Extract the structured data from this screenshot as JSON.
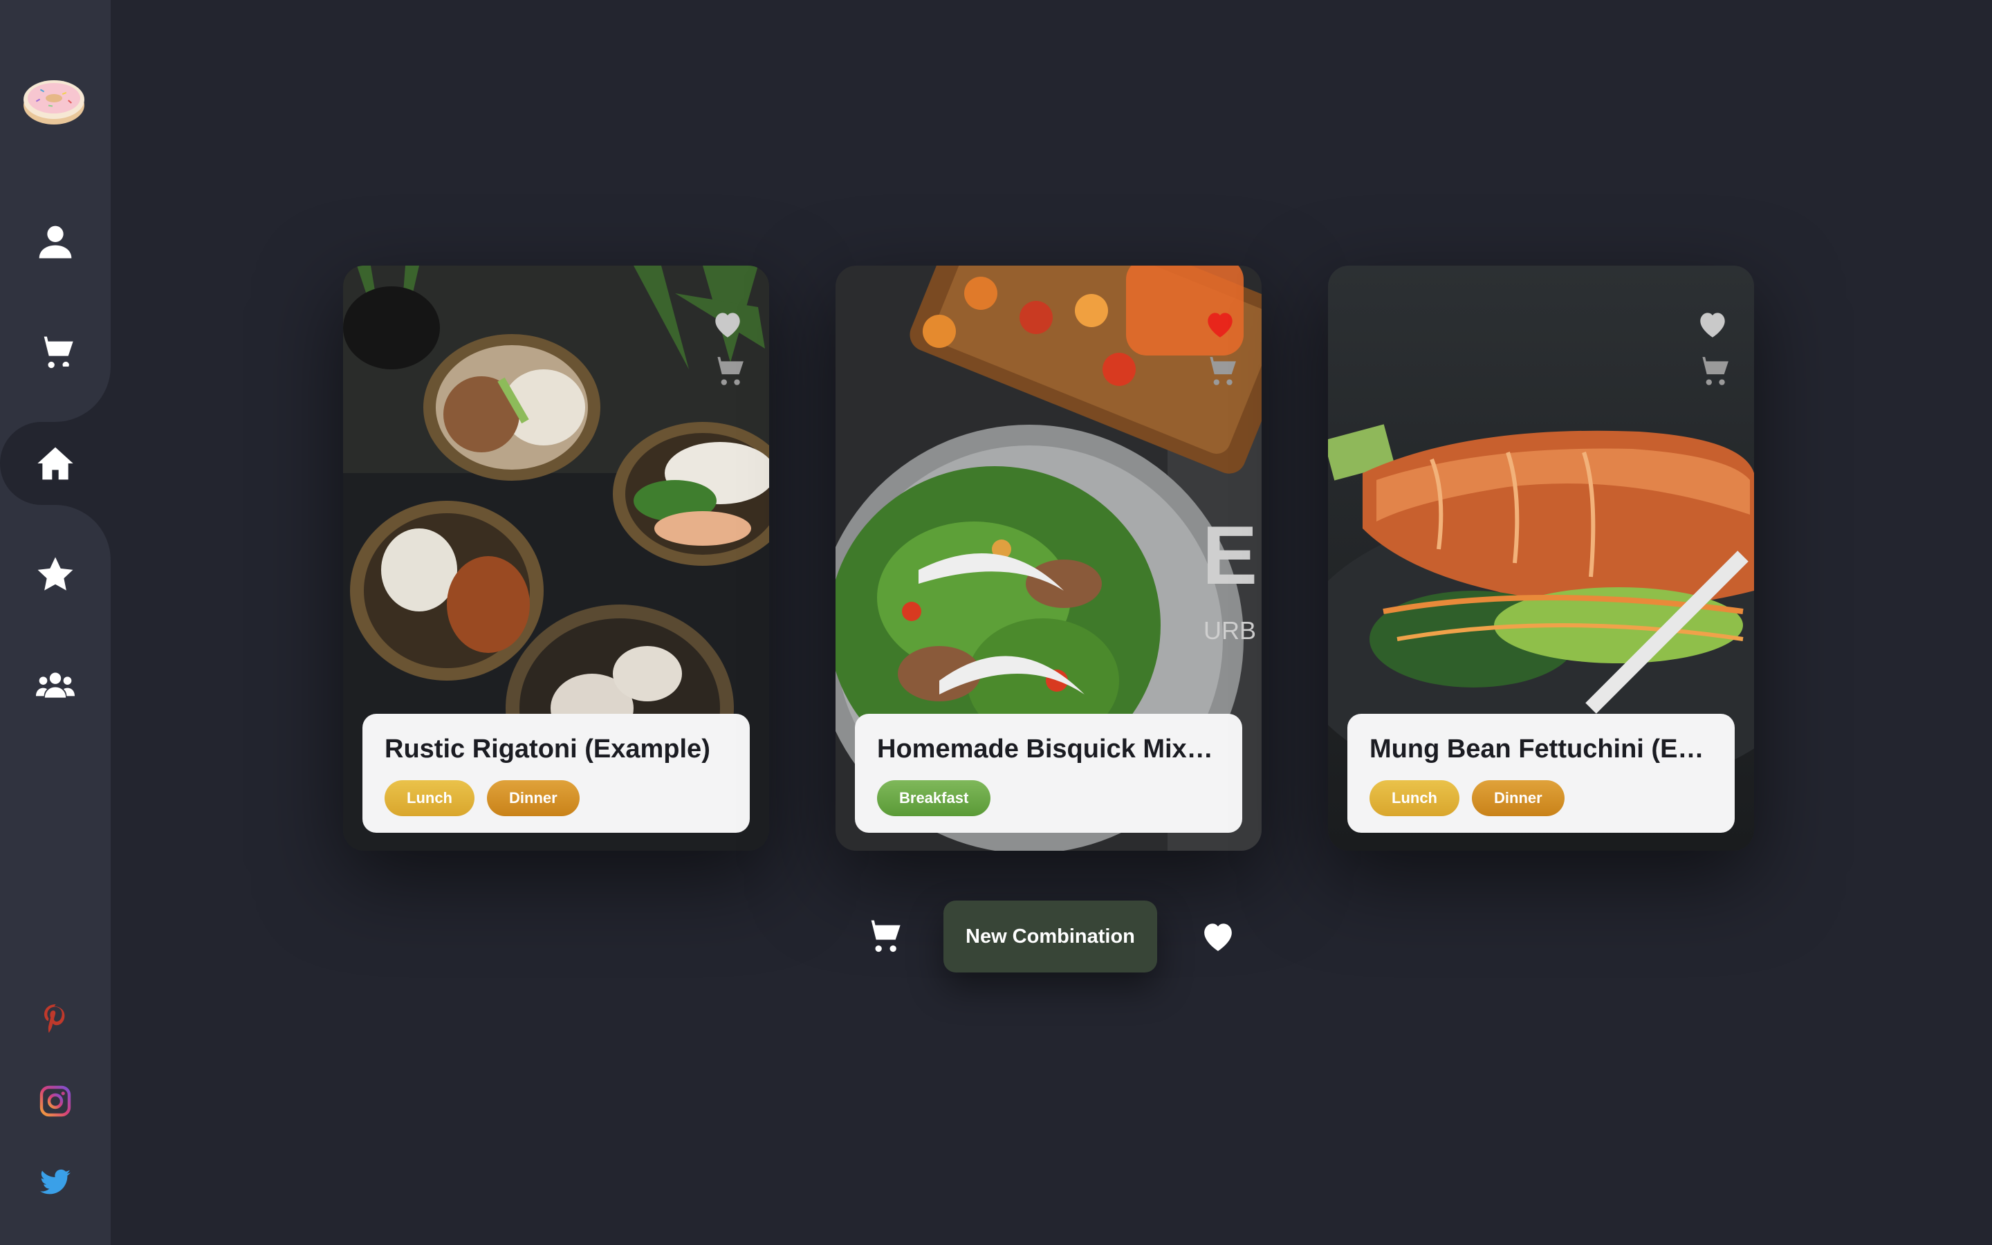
{
  "app": {
    "logo_icon": "donut-icon"
  },
  "sidebar": {
    "items": [
      {
        "name": "profile",
        "icon": "user-icon"
      },
      {
        "name": "cart",
        "icon": "cart-icon"
      },
      {
        "name": "home",
        "icon": "home-icon",
        "active": true
      },
      {
        "name": "favorites",
        "icon": "star-icon"
      },
      {
        "name": "community",
        "icon": "users-icon"
      }
    ],
    "social": [
      {
        "name": "pinterest",
        "icon": "pinterest-icon",
        "color": "#c0392b"
      },
      {
        "name": "instagram",
        "icon": "instagram-icon",
        "color": "#d6407a"
      },
      {
        "name": "twitter",
        "icon": "twitter-icon",
        "color": "#3aa0e8"
      }
    ]
  },
  "cards": [
    {
      "title": "Rustic Rigatoni (Example)",
      "tags": [
        {
          "label": "Lunch",
          "color": "#e2b53e"
        },
        {
          "label": "Dinner",
          "color": "#d48f2a"
        }
      ],
      "favorited": false
    },
    {
      "title": "Homemade Bisquick Mix: ...",
      "tags": [
        {
          "label": "Breakfast",
          "color": "#6aa846"
        }
      ],
      "favorited": true
    },
    {
      "title": "Mung Bean Fettuchini (Exa...",
      "tags": [
        {
          "label": "Lunch",
          "color": "#e2b53e"
        },
        {
          "label": "Dinner",
          "color": "#d48f2a"
        }
      ],
      "favorited": false
    }
  ],
  "controls": {
    "new_combination_label": "New Combination",
    "button_color": "#384537"
  }
}
